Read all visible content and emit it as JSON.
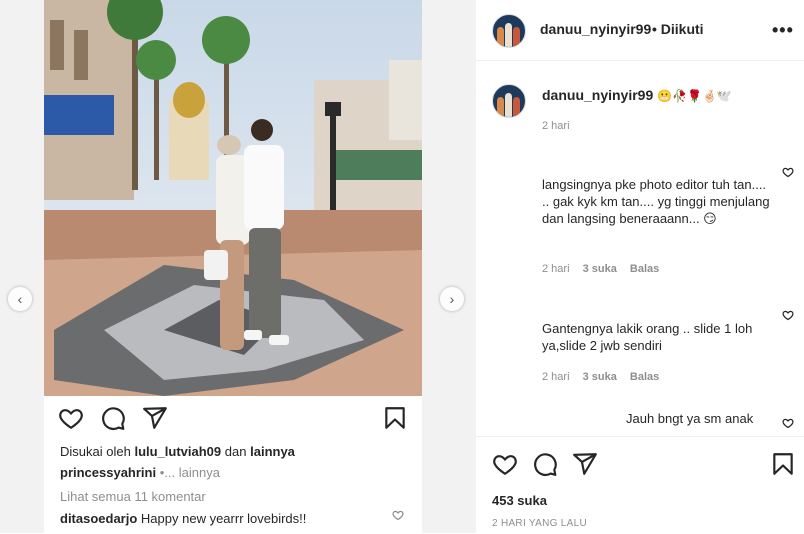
{
  "post": {
    "author": "danuu_nyinyir99",
    "follow_state": "Diikuti",
    "caption_emojis": "😬🥀🌹🤞🏻🕊️",
    "caption_time": "2 hari",
    "likes_count": "453 suka",
    "posted_ago": "2 HARI YANG LALU"
  },
  "left_card": {
    "liked_by_prefix": "Disukai oleh",
    "liked_by_user": "lulu_lutviah09",
    "liked_by_and": "dan",
    "liked_by_others": "lainnya",
    "second_user": "princessyahrini",
    "second_more": "•... lainnya",
    "view_all": "Lihat semua 11 komentar",
    "first_comment_user": "ditasoedarjo",
    "first_comment_text": "Happy new yearrr lovebirds!!"
  },
  "comments": [
    {
      "text": "langsingnya pke photo editor tuh tan.... .. gak kyk km tan.... yg tinggi menjulang dan langsing beneraaann... 😏",
      "time": "2 hari",
      "likes": "3 suka",
      "reply": "Balas"
    },
    {
      "text": "Gantengnya lakik orang .. slide 1 loh ya,slide 2 jwb sendiri",
      "time": "2 hari",
      "likes": "3 suka",
      "reply": "Balas"
    },
    {
      "text": "Jauh bngt ya sm anak",
      "time": "",
      "likes": "",
      "reply": ""
    }
  ],
  "icons": {
    "like": "heart-icon",
    "comment": "comment-icon",
    "share": "send-icon",
    "save": "bookmark-icon",
    "more": "more-options-icon",
    "prev": "chevron-left-icon",
    "next": "chevron-right-icon"
  }
}
